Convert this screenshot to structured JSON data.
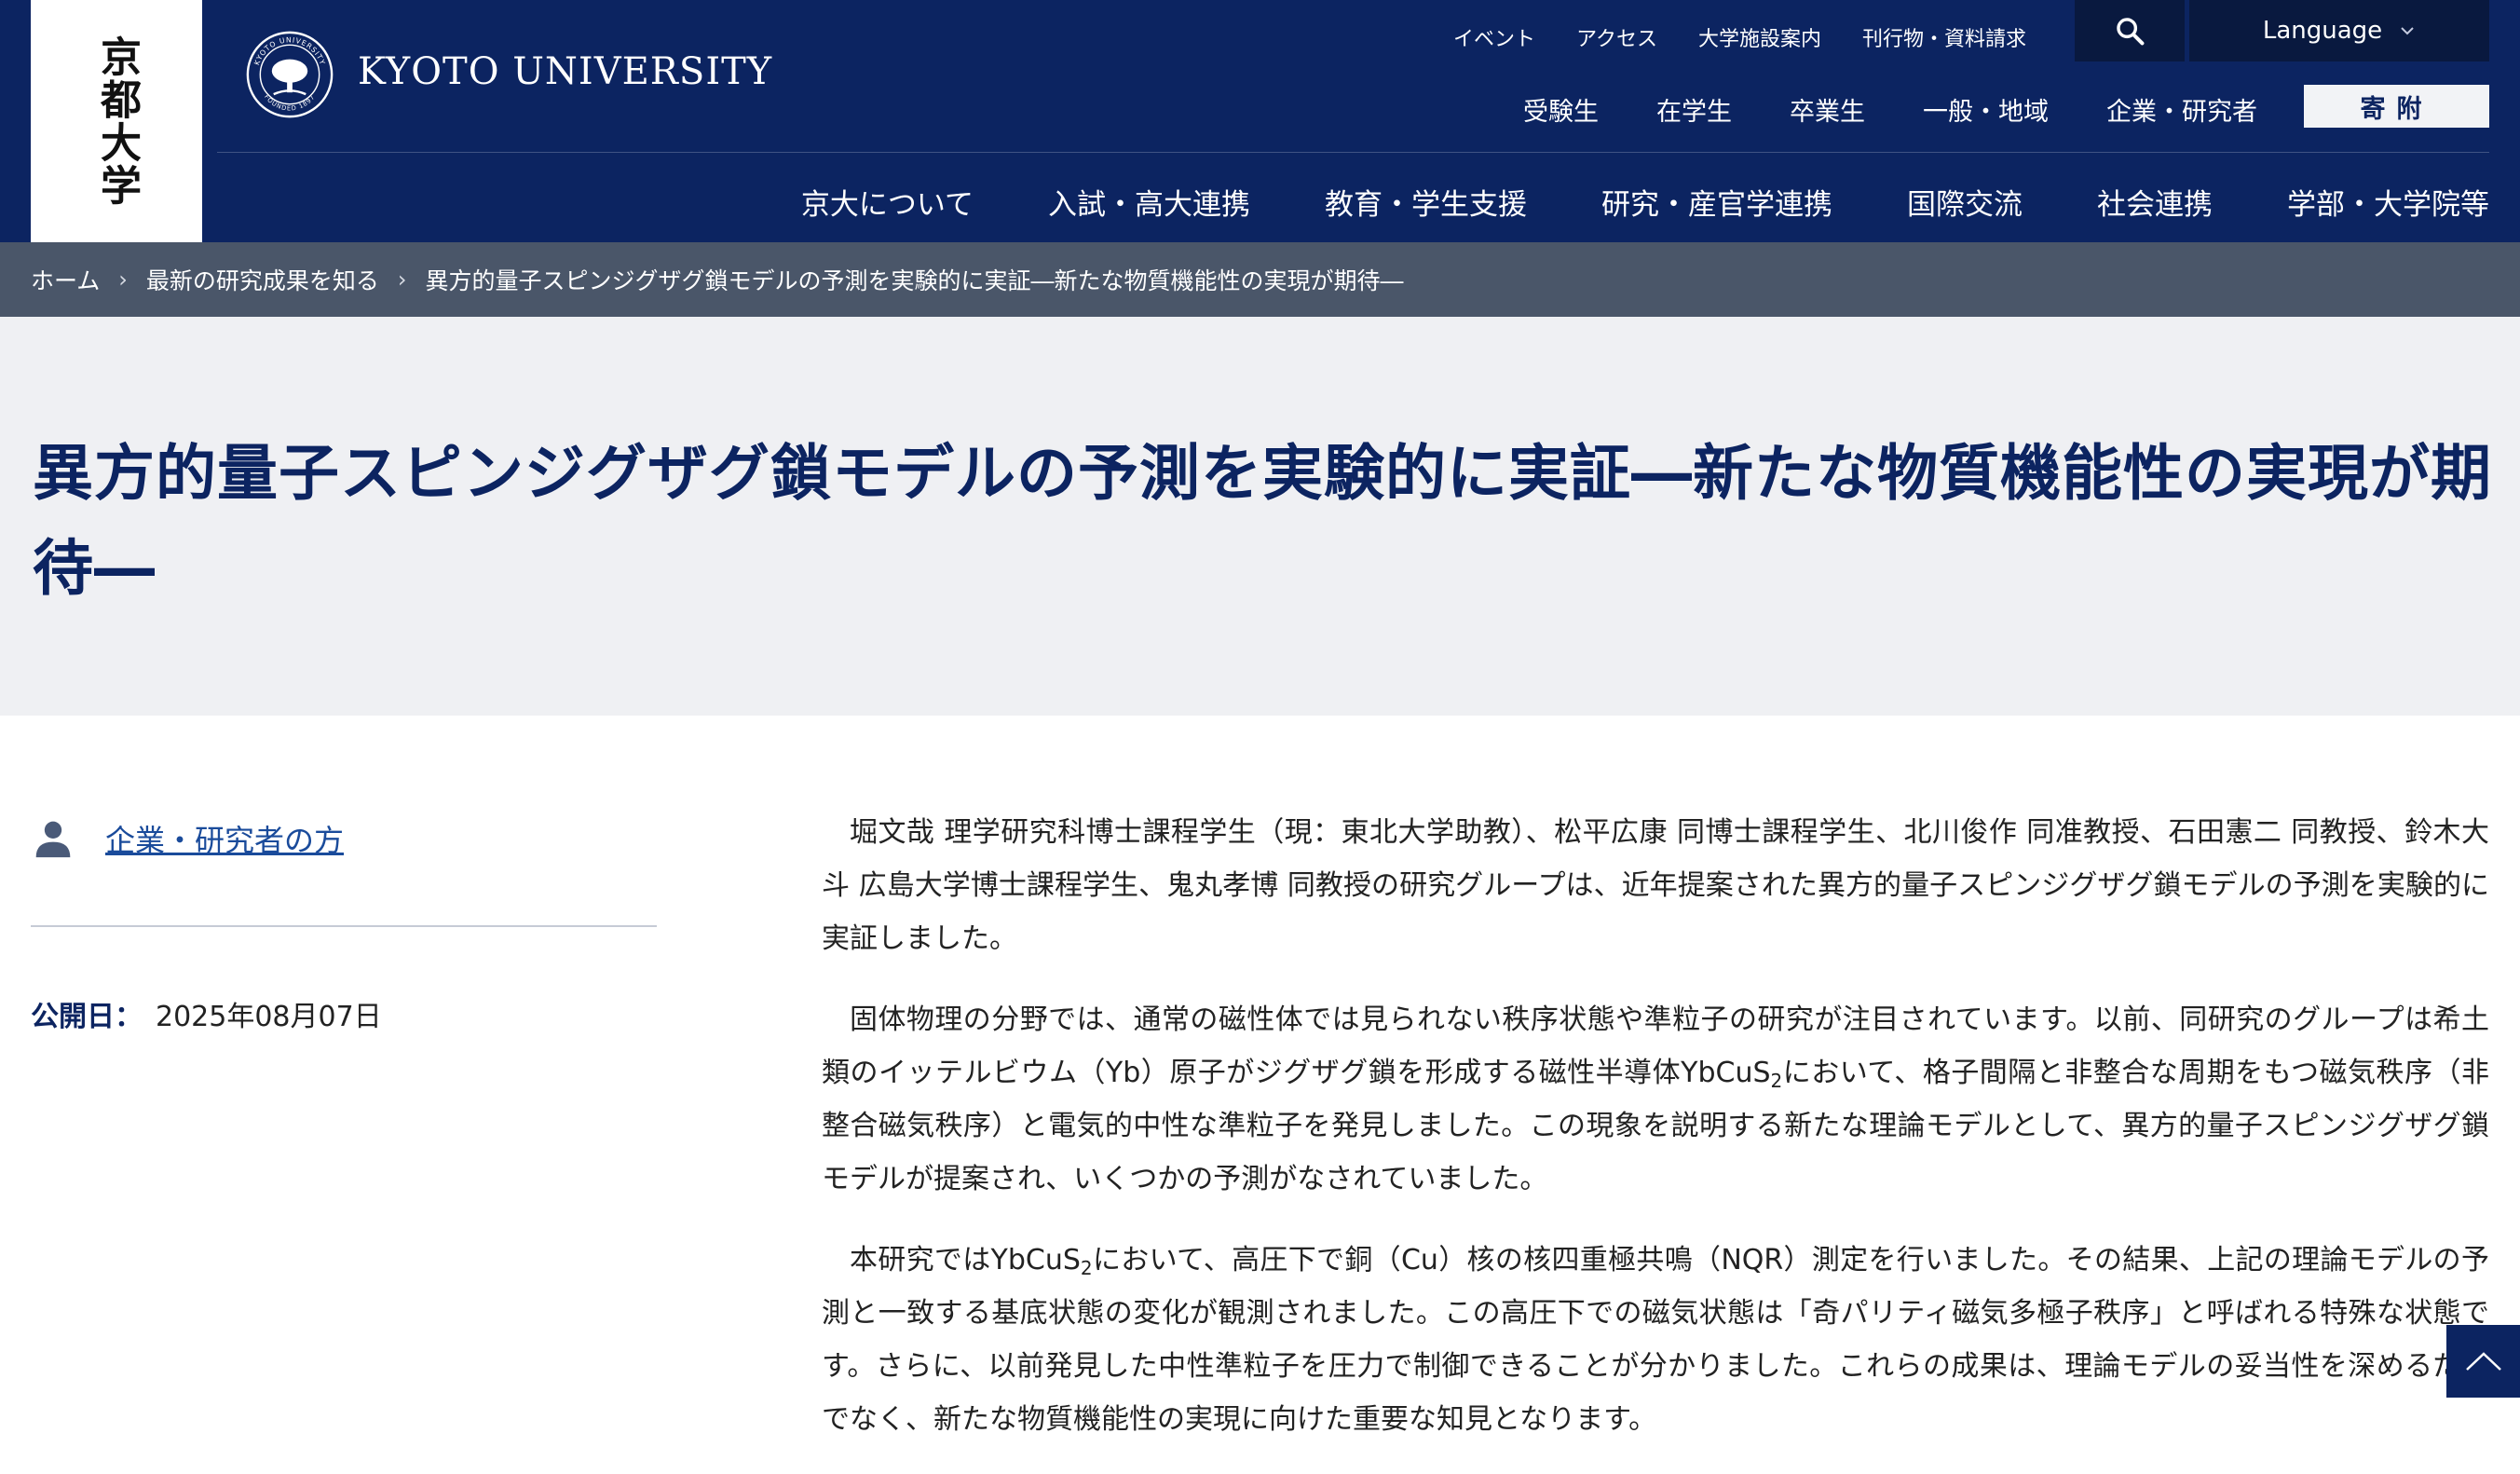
{
  "header": {
    "logo_text": "京都大学",
    "university_name": "KYOTO UNIVERSITY",
    "emblem": {
      "top_text": "KYOTO UNIVERSITY",
      "bottom_text": "FOUNDED 1897"
    },
    "utility_nav": [
      "イベント",
      "アクセス",
      "大学施設案内",
      "刊行物・資料請求"
    ],
    "search_icon": "search-icon",
    "language_label": "Language",
    "audience_nav": [
      "受験生",
      "在学生",
      "卒業生",
      "一般・地域",
      "企業・研究者"
    ],
    "donate_label": "寄附",
    "main_nav": [
      "京大について",
      "入試・高大連携",
      "教育・学生支援",
      "研究・産官学連携",
      "国際交流",
      "社会連携",
      "学部・大学院等"
    ],
    "colors": {
      "navy": "#0c2461",
      "breadcrumb_bg": "#4a5669",
      "title_band_bg": "#eff0f3",
      "link": "#1a4b9b"
    }
  },
  "breadcrumb": {
    "items": [
      "ホーム",
      "最新の研究成果を知る",
      "異方的量子スピンジグザグ鎖モデルの予測を実験的に実証―新たな物質機能性の実現が期待―"
    ],
    "separator": "›"
  },
  "page_title": "異方的量子スピンジグザグ鎖モデルの予測を実験的に実証―新たな物質機能性の実現が期待―",
  "sidebar": {
    "category_icon": "person-icon",
    "category_label": "企業・研究者の方",
    "published_label": "公開日：",
    "published_date": "2025年08月07日"
  },
  "article": {
    "p1": "堀文哉 理学研究科博士課程学生（現：東北大学助教）、松平広康 同博士課程学生、北川俊作 同准教授、石田憲二 同教授、鈴木大斗 広島大学博士課程学生、鬼丸孝博 同教授の研究グループは、近年提案された異方的量子スピンジグザグ鎖モデルの予測を実験的に実証しました。",
    "p2_a": "固体物理の分野では、通常の磁性体では見られない秩序状態や準粒子の研究が注目されています。以前、同研究のグループは希土類のイッテルビウム（Yb）原子がジグザグ鎖を形成する磁性半導体YbCuS",
    "p2_sub": "2",
    "p2_b": "において、格子間隔と非整合な周期をもつ磁気秩序（非整合磁気秩序）と電気的中性な準粒子を発見しました。この現象を説明する新たな理論モデルとして、異方的量子スピンジグザグ鎖モデルが提案され、いくつかの予測がなされていました。",
    "p3_a": "本研究ではYbCuS",
    "p3_sub": "2",
    "p3_b": "において、高圧下で銅（Cu）核の核四重極共鳴（NQR）測定を行いました。その結果、上記の理論モデルの予測と一致する基底状態の変化が観測されました。この高圧下での磁気状態は「奇パリティ磁気多極子秩序」と呼ばれる特殊な状態です。さらに、以前発見した中性準粒子を圧力で制御できることが分かりました。これらの成果は、理論モデルの妥当性を深めるだけでなく、新たな物質機能性の実現に向けた重要な知見となります。"
  },
  "back_to_top_icon": "chevron-up-icon"
}
